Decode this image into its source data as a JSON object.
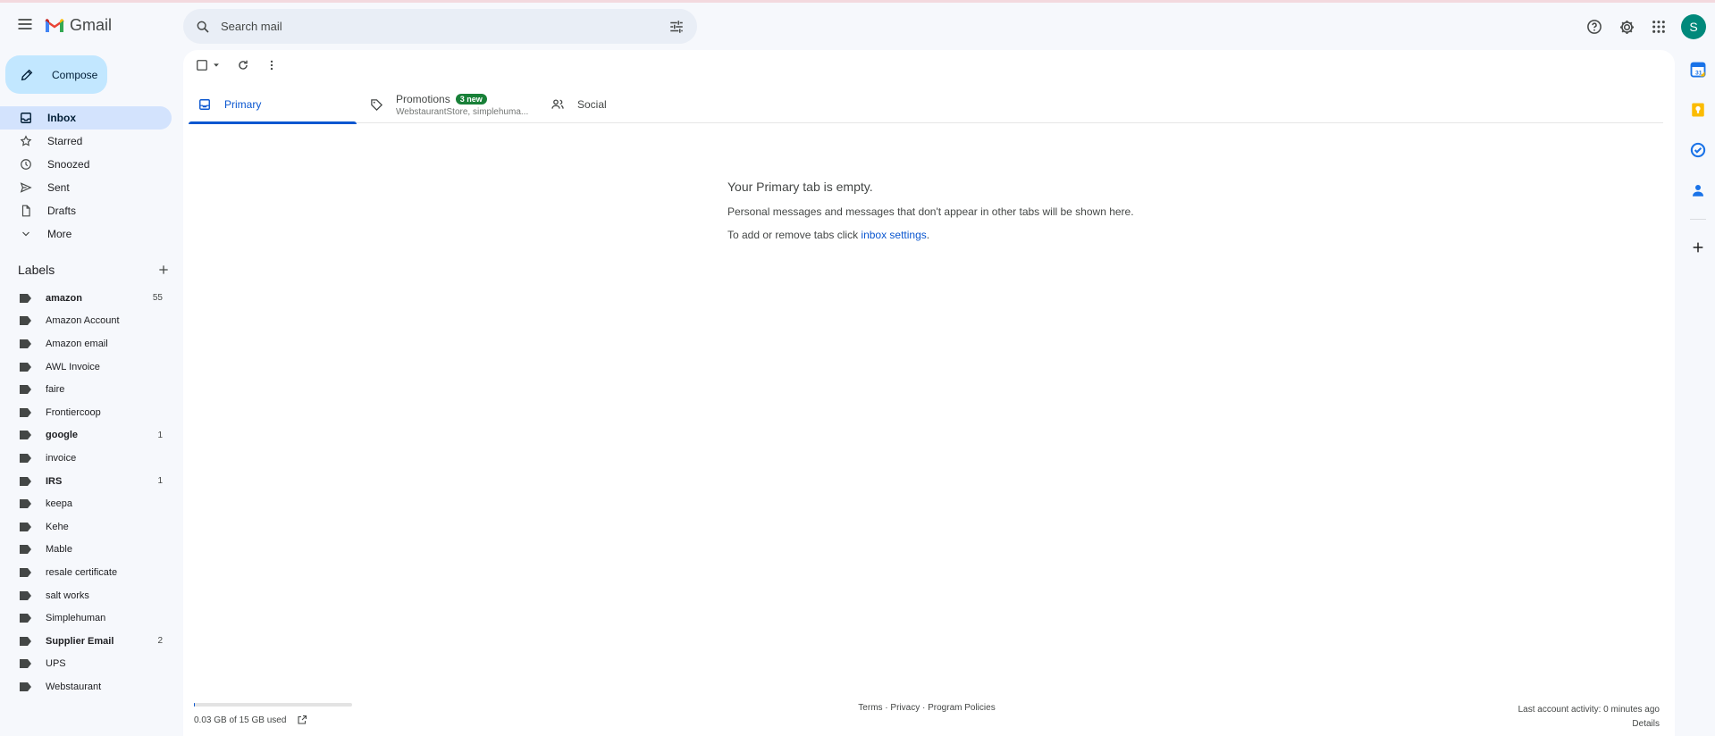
{
  "app": {
    "name": "Gmail"
  },
  "search": {
    "placeholder": "Search mail"
  },
  "account": {
    "initial": "S"
  },
  "compose": {
    "label": "Compose"
  },
  "nav": [
    {
      "label": "Inbox",
      "icon": "inbox-icon",
      "active": true
    },
    {
      "label": "Starred",
      "icon": "star-icon"
    },
    {
      "label": "Snoozed",
      "icon": "clock-icon"
    },
    {
      "label": "Sent",
      "icon": "send-icon"
    },
    {
      "label": "Drafts",
      "icon": "draft-icon"
    },
    {
      "label": "More",
      "icon": "chevron-down-icon"
    }
  ],
  "labels": {
    "title": "Labels",
    "items": [
      {
        "name": "amazon",
        "count": "55",
        "bold": true
      },
      {
        "name": "Amazon Account",
        "count": ""
      },
      {
        "name": "Amazon email",
        "count": ""
      },
      {
        "name": "AWL Invoice",
        "count": ""
      },
      {
        "name": "faire",
        "count": ""
      },
      {
        "name": "Frontiercoop",
        "count": ""
      },
      {
        "name": "google",
        "count": "1",
        "bold": true
      },
      {
        "name": "invoice",
        "count": ""
      },
      {
        "name": "IRS",
        "count": "1",
        "bold": true
      },
      {
        "name": "keepa",
        "count": ""
      },
      {
        "name": "Kehe",
        "count": ""
      },
      {
        "name": "Mable",
        "count": ""
      },
      {
        "name": "resale certificate",
        "count": ""
      },
      {
        "name": "salt works",
        "count": ""
      },
      {
        "name": "Simplehuman",
        "count": ""
      },
      {
        "name": "Supplier Email",
        "count": "2",
        "bold": true
      },
      {
        "name": "UPS",
        "count": ""
      },
      {
        "name": "Webstaurant",
        "count": ""
      }
    ]
  },
  "tabs": {
    "primary": "Primary",
    "promotions": "Promotions",
    "promotions_badge": "3 new",
    "promotions_senders": "WebstaurantStore, simplehuma...",
    "social": "Social"
  },
  "empty_state": {
    "title": "Your Primary tab is empty.",
    "line1": "Personal messages and messages that don't appear in other tabs will be shown here.",
    "line2_prefix": "To add or remove tabs click ",
    "line2_link": "inbox settings",
    "line2_suffix": "."
  },
  "footer": {
    "storage": "0.03 GB of 15 GB used",
    "storage_fraction": 0.002,
    "terms": "Terms",
    "privacy": "Privacy",
    "program_policies": "Program Policies",
    "separator": " · ",
    "last_activity": "Last account activity: 0 minutes ago",
    "details": "Details"
  },
  "colors": {
    "accent": "#0b57d0",
    "compose_bg": "#c2e7ff",
    "active_nav": "#d3e3fd",
    "badge": "#188038",
    "avatar": "#00897b"
  }
}
